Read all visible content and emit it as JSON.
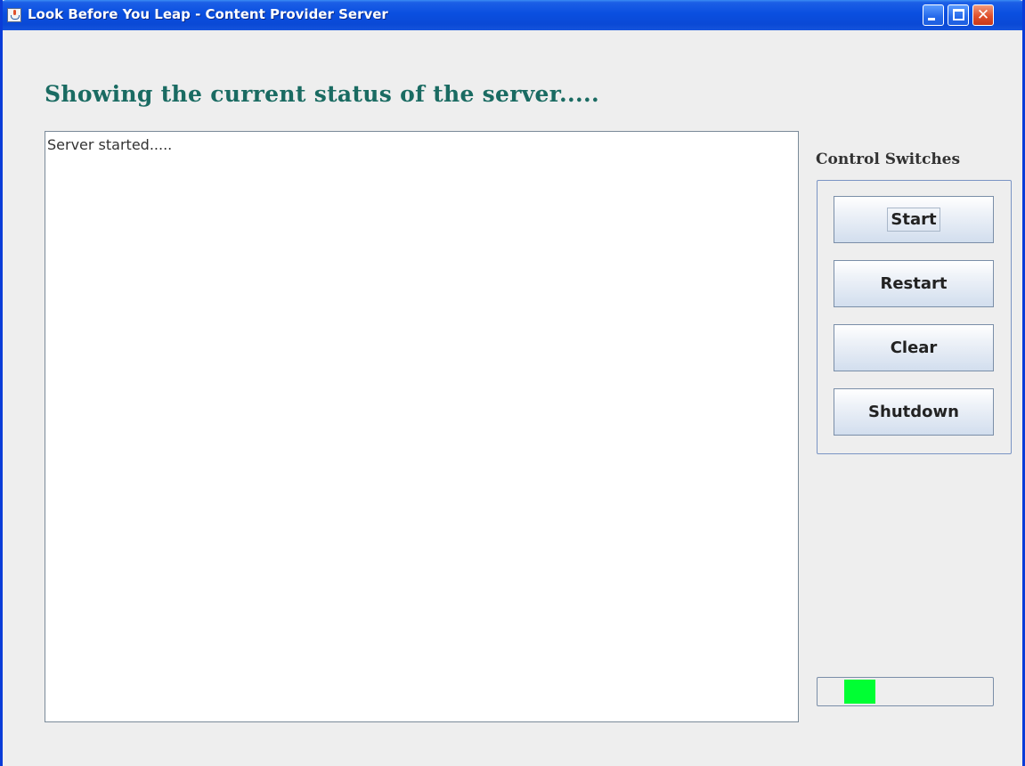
{
  "window": {
    "title": "Look Before You Leap - Content Provider Server",
    "app_icon": "java-cup-icon",
    "controls": {
      "minimize_icon": "minimize-icon",
      "maximize_icon": "maximize-icon",
      "close_icon": "close-icon",
      "close_glyph": "✕"
    },
    "titlebar_color": "#0a4fe0",
    "close_color": "#e0502c"
  },
  "main": {
    "heading": "Showing the current status of the server.....",
    "heading_color": "#1a6b62",
    "log_text": "Server started....."
  },
  "controls": {
    "label": "Control Switches",
    "buttons": [
      {
        "label": "Start"
      },
      {
        "label": "Restart"
      },
      {
        "label": "Clear"
      },
      {
        "label": "Shutdown"
      }
    ]
  },
  "activity_indicator": {
    "type": "indeterminate-progress",
    "fill_color": "#00ff33",
    "segment_start_fraction": 0.15,
    "segment_end_fraction": 0.33
  }
}
